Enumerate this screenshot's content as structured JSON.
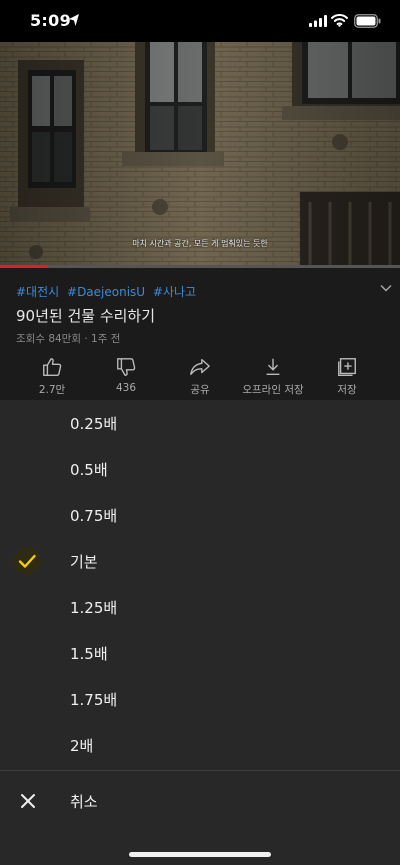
{
  "status_bar": {
    "time": "5:09",
    "icons": [
      "location-arrow-icon",
      "cellular-signal-icon",
      "wifi-icon",
      "battery-icon"
    ]
  },
  "player": {
    "subtitle": "마치 시간과 공간, 모든 게 멈춰있는 듯한",
    "progress_fraction": 0.12,
    "progress_color": "#e02020"
  },
  "video": {
    "hashtags": [
      "#대전시",
      "#DaejeonisU",
      "#사나고"
    ],
    "title": "90년된 건물 수리하기",
    "meta": "조회수 84만회 · 1주 전",
    "hashtag_color": "#3e8ad8"
  },
  "actions": [
    {
      "icon": "thumbs-up-icon",
      "label": "2.7만"
    },
    {
      "icon": "thumbs-down-icon",
      "label": "436"
    },
    {
      "icon": "share-icon",
      "label": "공유"
    },
    {
      "icon": "download-icon",
      "label": "오프라인 저장"
    },
    {
      "icon": "add-to-playlist-icon",
      "label": "저장"
    }
  ],
  "speed_sheet": {
    "options": [
      {
        "label": "0.25배",
        "selected": false
      },
      {
        "label": "0.5배",
        "selected": false
      },
      {
        "label": "0.75배",
        "selected": false
      },
      {
        "label": "기본",
        "selected": true
      },
      {
        "label": "1.25배",
        "selected": false
      },
      {
        "label": "1.5배",
        "selected": false
      },
      {
        "label": "1.75배",
        "selected": false
      },
      {
        "label": "2배",
        "selected": false
      }
    ],
    "cancel_label": "취소",
    "check_color": "#f5d000"
  }
}
